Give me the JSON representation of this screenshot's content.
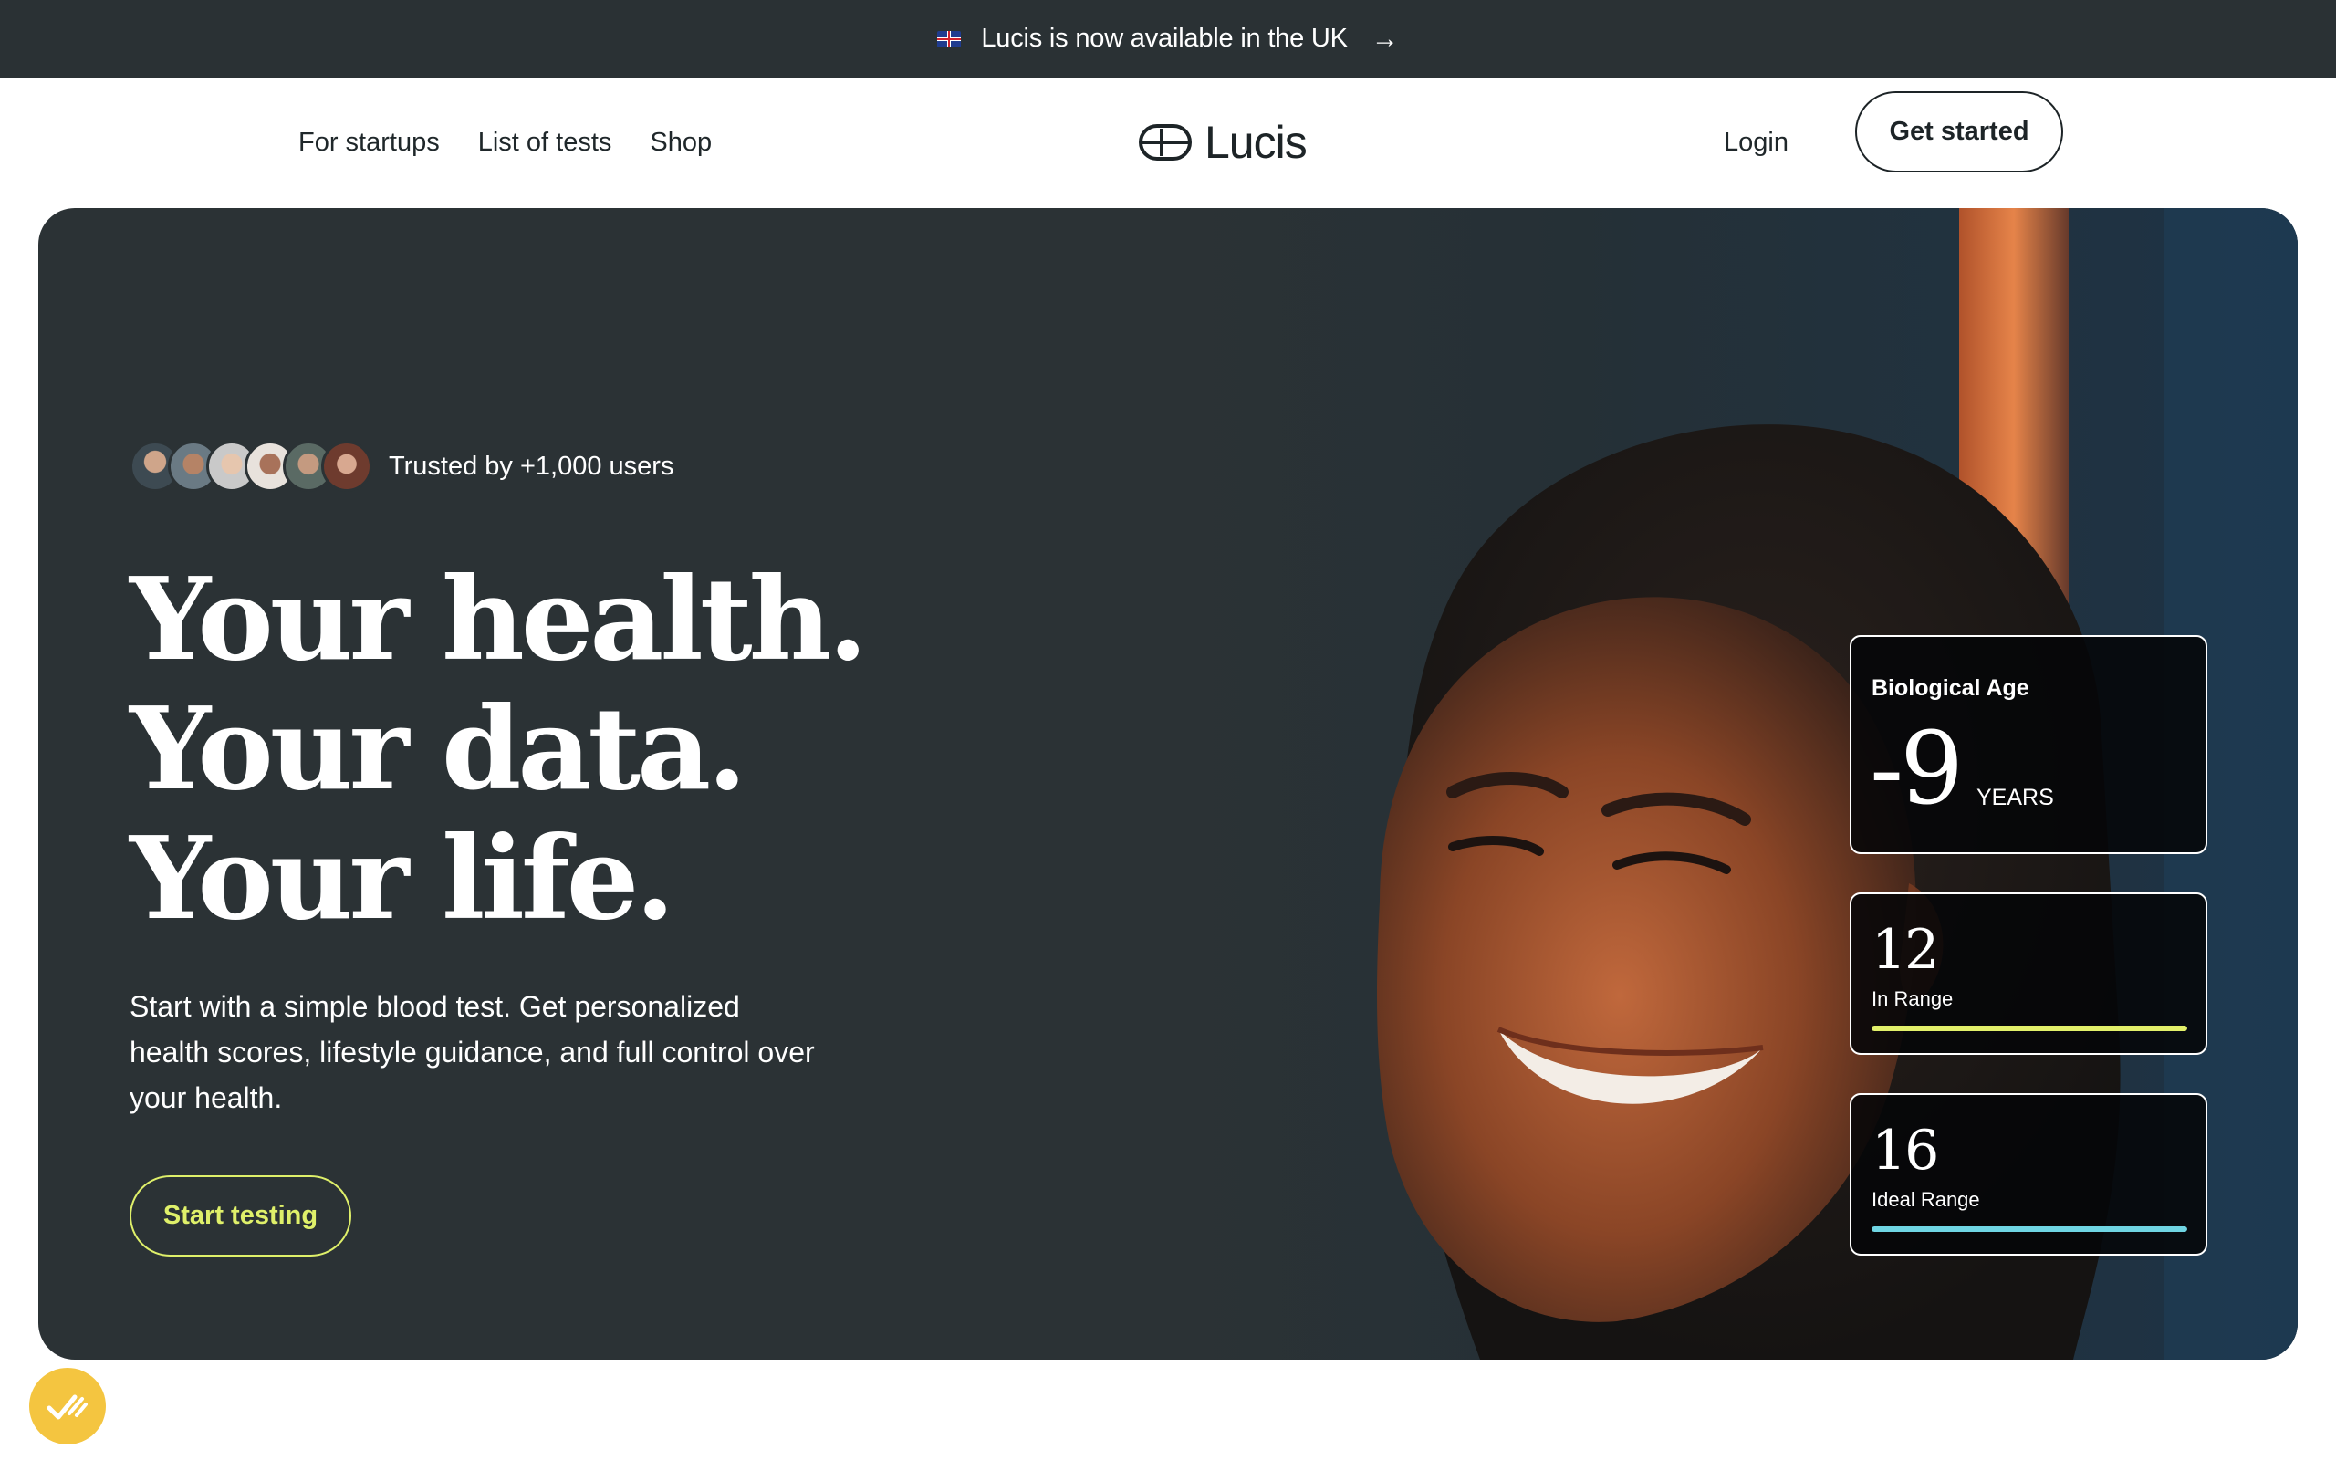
{
  "announcement": {
    "text": "Lucis is now available in the UK",
    "arrow": "→",
    "flag_icon": "uk-flag-icon"
  },
  "nav": {
    "links": [
      "For startups",
      "List of tests",
      "Shop"
    ],
    "logo_text": "Lucis",
    "login": "Login",
    "cta": "Get started"
  },
  "hero": {
    "trusted_text": "Trusted by +1,000 users",
    "headline": [
      "Your health.",
      "Your data.",
      "Your life."
    ],
    "subtext": "Start with a simple blood test. Get personalized health scores, lifestyle guidance, and full control over your health.",
    "cta": "Start testing"
  },
  "cards": {
    "biological_age": {
      "label": "Biological Age",
      "value": "-9",
      "unit": "YEARS"
    },
    "in_range": {
      "value": "12",
      "label": "In Range",
      "bar_fill": 1.0,
      "bar_color": "#e2f06a"
    },
    "ideal_range": {
      "value": "16",
      "label": "Ideal Range",
      "bar_fill": 1.0,
      "bar_color": "#6fd5e3"
    }
  },
  "colors": {
    "topbar_bg": "#2a3134",
    "hero_bg": "#2b3235",
    "accent_lime": "#dff06a",
    "accent_cyan": "#6fd5e3",
    "widget_yellow": "#f4c540"
  }
}
